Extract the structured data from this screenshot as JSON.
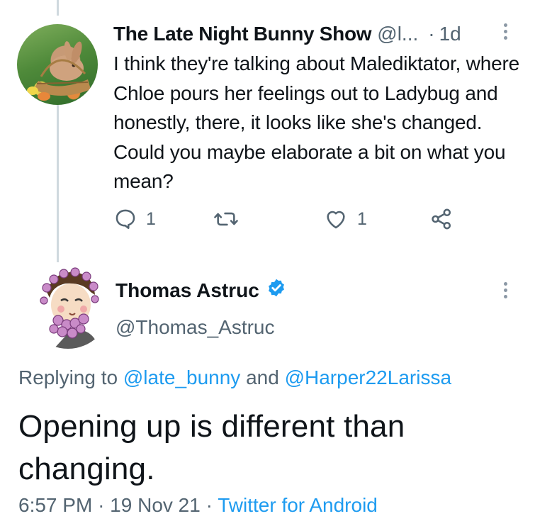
{
  "reply_tweet": {
    "display_name": "The Late Night Bunny Show",
    "handle": "@l...",
    "separator": "·",
    "time": "1d",
    "text": "I think they're talking about Malediktator, where Chloe pours her feelings out to Ladybug and honestly, there, it looks like she's changed. Could you maybe elaborate a bit on what you mean?",
    "actions": {
      "reply_count": "1",
      "retweet_count": "",
      "like_count": "1"
    }
  },
  "main_tweet": {
    "display_name": "Thomas Astruc",
    "handle": "@Thomas_Astruc",
    "replying_prefix": "Replying to",
    "replying_to_1": "@late_bunny",
    "replying_and": "and",
    "replying_to_2": "@Harper22Larissa",
    "text": "Opening up is different than changing.",
    "time": "6:57 PM",
    "date": "19 Nov 21",
    "separator": "·",
    "client": "Twitter for Android"
  },
  "icons": {
    "reply": "reply-icon",
    "retweet": "retweet-icon",
    "like": "heart-icon",
    "share": "share-icon",
    "more": "more-vertical-icon",
    "verified": "verified-badge-icon"
  },
  "colors": {
    "link": "#1d9bf0",
    "secondary_text": "#536471",
    "primary_text": "#0f1419",
    "verified": "#1d9bf0",
    "thread_line": "#cfd9de"
  }
}
